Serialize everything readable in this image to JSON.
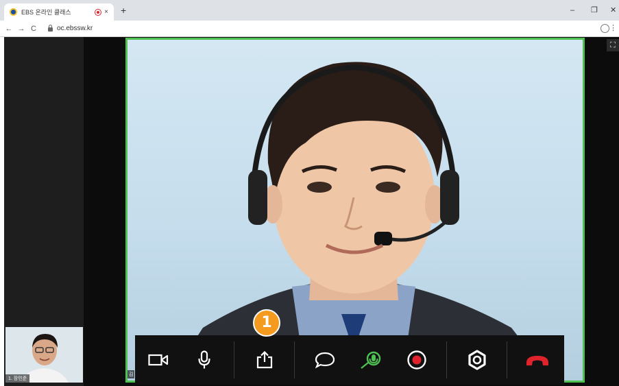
{
  "browser": {
    "tab_title": "EBS 온라인 클래스",
    "tab_close": "×",
    "new_tab": "+",
    "url": "oc.ebssw.kr",
    "back": "←",
    "forward": "→",
    "reload": "C",
    "minimize": "–",
    "restore": "❐",
    "close": "✕",
    "menu": "⋮"
  },
  "conference": {
    "thumbnail_name": "1. 장민준",
    "main_label": "김",
    "fullscreen": "⛶",
    "step_badge": "1"
  },
  "toolbar": {
    "items": [
      {
        "icon": "video-camera-icon"
      },
      {
        "icon": "microphone-icon"
      },
      {
        "icon": "share-screen-icon"
      },
      {
        "icon": "chat-icon"
      },
      {
        "icon": "speaker-mic-icon",
        "color": "#4fc152"
      },
      {
        "icon": "record-icon",
        "color": "#e0232b"
      },
      {
        "icon": "settings-icon"
      },
      {
        "icon": "hang-up-icon",
        "color": "#e0232b"
      }
    ]
  },
  "colors": {
    "active_border": "#4fc152",
    "badge": "#f39a1f",
    "record": "#e0232b"
  }
}
